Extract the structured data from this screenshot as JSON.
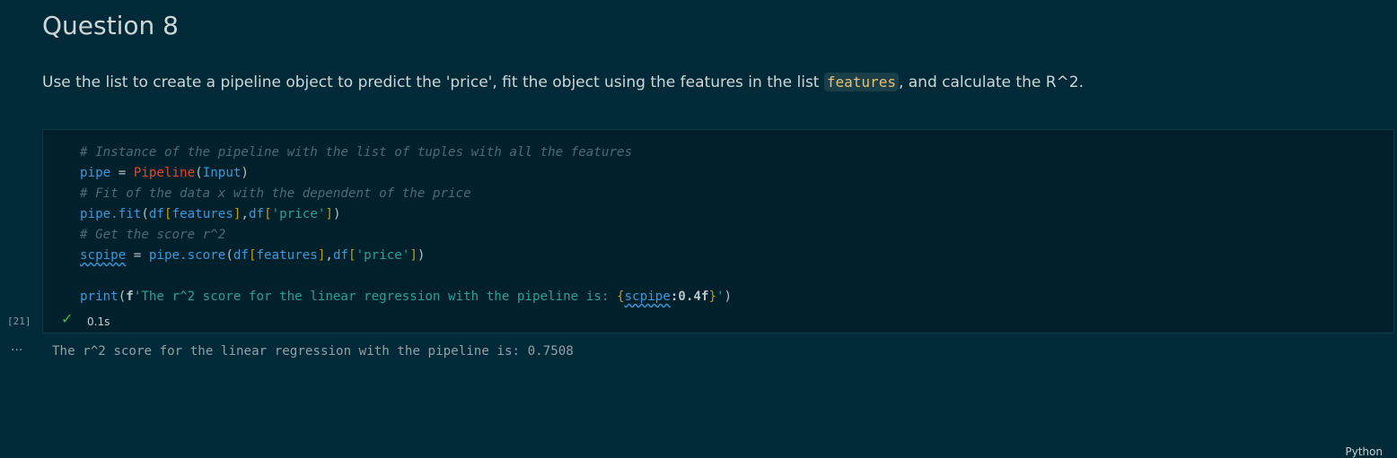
{
  "markdown": {
    "title": "Question 8",
    "para_before": "Use the list to create a pipeline object to predict the 'price', fit the object using the features in the list ",
    "inline_code": "features",
    "para_after": ", and calculate the R^2."
  },
  "cell": {
    "execution_count": "[21]",
    "status_icon": "check-icon",
    "duration": "0.1s",
    "language": "Python",
    "code": {
      "l1": "# Instance of the pipeline with the list of tuples with all the features",
      "l3": "# Fit of the data x with the dependent of the price",
      "l5": "# Get the score r^2"
    }
  },
  "output": {
    "icon": "ellipsis-icon",
    "text": "The r^2 score for the linear regression with the pipeline is: 0.7508"
  },
  "colors": {
    "background": "#002a37",
    "cell_background": "#00212b",
    "success": "#3fb950"
  }
}
